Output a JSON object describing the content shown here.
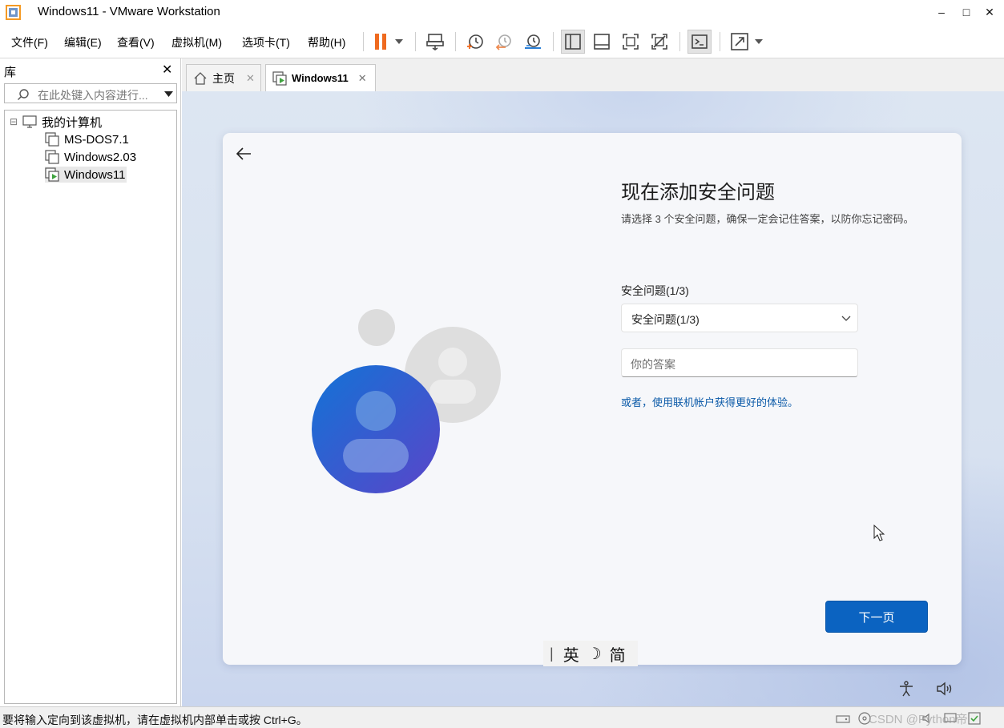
{
  "window": {
    "title": "Windows11 - VMware Workstation",
    "minimize_glyph": "–",
    "maximize_glyph": "□",
    "close_glyph": "✕"
  },
  "menu": {
    "file": "文件(F)",
    "edit": "编辑(E)",
    "view": "查看(V)",
    "vm": "虚拟机(M)",
    "tabs": "选项卡(T)",
    "help": "帮助(H)"
  },
  "toolbar": {
    "icons": [
      "pause-icon",
      "dropdown-icon",
      "send-ctrl-alt-del-icon",
      "snapshot-icon",
      "revert-snapshot-icon",
      "snapshot-manager-icon",
      "library-view-icon",
      "thumbnail-bar-icon",
      "fullscreen-icon",
      "unity-icon",
      "console-icon",
      "stretch-icon",
      "dropdown-icon"
    ]
  },
  "library": {
    "title": "库",
    "close_glyph": "✕",
    "search_placeholder": "在此处键入内容进行...",
    "tree": {
      "root": "我的计算机",
      "collapse_glyph": "⊟",
      "items": [
        "MS-DOS7.1",
        "Windows2.03",
        "Windows11"
      ]
    }
  },
  "tabs": {
    "home": "主页",
    "vm": "Windows11",
    "close_glyph": "✕"
  },
  "oobe": {
    "title": "现在添加安全问题",
    "description": "请选择 3 个安全问题，确保一定会记住答案，以防你忘记密码。",
    "question_label": "安全问题(1/3)",
    "question_value": "安全问题(1/3)",
    "answer_placeholder": "你的答案",
    "alt_link": "或者，使用联机帐户获得更好的体验。",
    "next_button": "下一页"
  },
  "ime": {
    "caret": "|",
    "lang": "英",
    "mode_glyph": "☽",
    "script": "简"
  },
  "status_bar": {
    "message": "要将输入定向到该虚拟机，请在虚拟机内部单击或按 Ctrl+G。",
    "watermark": "CSDN @Python帝"
  },
  "colors": {
    "accent": "#0b63c1",
    "link": "#0b5aa8",
    "pause": "#ef6a1f"
  }
}
